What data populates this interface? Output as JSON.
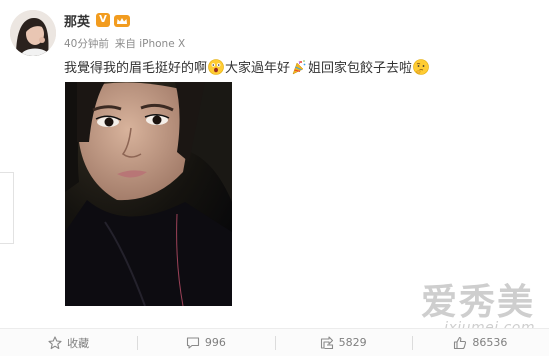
{
  "post": {
    "username": "那英",
    "verified_badge": "V",
    "time": "40分钟前",
    "source": "来自 iPhone X",
    "text_part1": "我覺得我的眉毛挺好的啊",
    "text_part2": "大家過年好",
    "text_part3": "姐回家包餃子去啦"
  },
  "icons": [
    "verified-icon",
    "crown-icon",
    "shocked-face-emoji",
    "party-popper-emoji",
    "thinking-face-emoji",
    "star-icon",
    "comment-icon",
    "share-icon",
    "like-icon"
  ],
  "actions": {
    "favorite_label": "收藏",
    "comment_count": "996",
    "repost_count": "5829",
    "like_count": "86536"
  },
  "watermark": {
    "chinese": "爱秀美",
    "url": "ixiumei.com"
  },
  "colors": {
    "text": "#333333",
    "meta": "#8c8c8c",
    "badge_orange": "#f29c1f",
    "action_text": "#808080"
  }
}
